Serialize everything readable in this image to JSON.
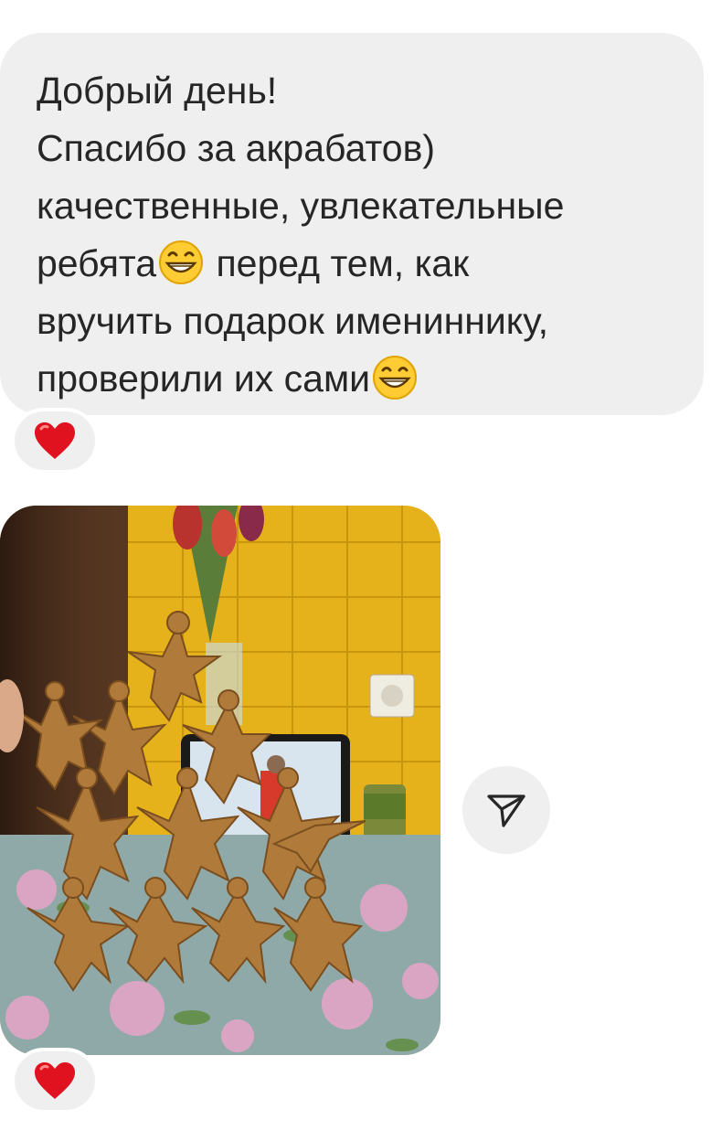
{
  "message": {
    "line1": "Добрый день!",
    "line2": "Спасибо за акрабатов)",
    "line3": "качественные, увлекательные",
    "line4_a": "ребята",
    "line4_b": " перед тем, как",
    "line5": "вручить подарок имениннику,",
    "line6": "проверили их сами",
    "emoji_icon": "grinning-face-icon",
    "reaction_icon": "red-heart-icon"
  },
  "photo": {
    "subject": "wooden-acrobat-figures-photo",
    "reaction_icon": "red-heart-icon"
  },
  "share_icon": "send-paper-plane-icon",
  "colors": {
    "bubble_bg": "#efefef",
    "text": "#262626",
    "heart": "#e0121f"
  }
}
